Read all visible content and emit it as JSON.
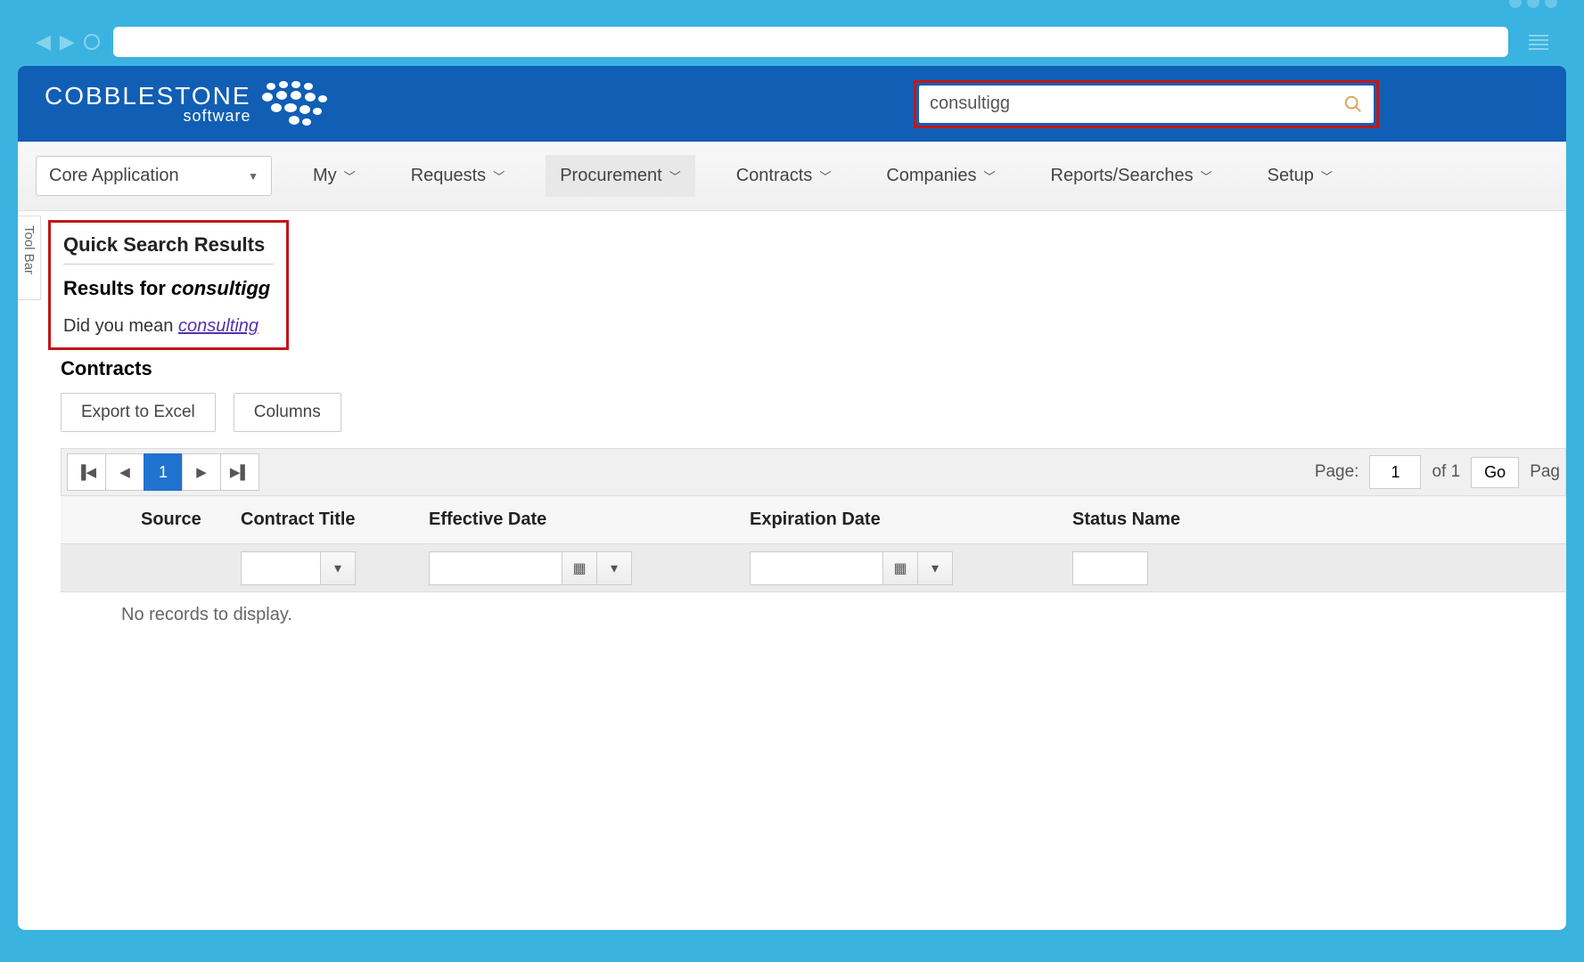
{
  "brand": {
    "name": "COBBLESTONE",
    "sub": "software"
  },
  "search": {
    "value": "consultigg"
  },
  "app_selector": {
    "label": "Core Application"
  },
  "nav": {
    "items": [
      {
        "label": "My"
      },
      {
        "label": "Requests"
      },
      {
        "label": "Procurement"
      },
      {
        "label": "Contracts"
      },
      {
        "label": "Companies"
      },
      {
        "label": "Reports/Searches"
      },
      {
        "label": "Setup"
      }
    ]
  },
  "sidebar": {
    "tool_bar": "Tool Bar"
  },
  "results": {
    "title": "Quick Search Results",
    "results_prefix": "Results for ",
    "results_term": "consultigg",
    "dym_prefix": "Did you mean ",
    "dym_link": "consulting"
  },
  "section": {
    "title": "Contracts"
  },
  "actions": {
    "export": "Export to Excel",
    "columns": "Columns"
  },
  "pager": {
    "current_page": "1",
    "page_label": "Page:",
    "page_value": "1",
    "of_label": "of 1",
    "go": "Go",
    "page_size_label": "Pag"
  },
  "columns": {
    "source": "Source",
    "contract_title": "Contract Title",
    "effective_date": "Effective Date",
    "expiration_date": "Expiration Date",
    "status_name": "Status Name"
  },
  "grid": {
    "empty": "No records to display."
  }
}
